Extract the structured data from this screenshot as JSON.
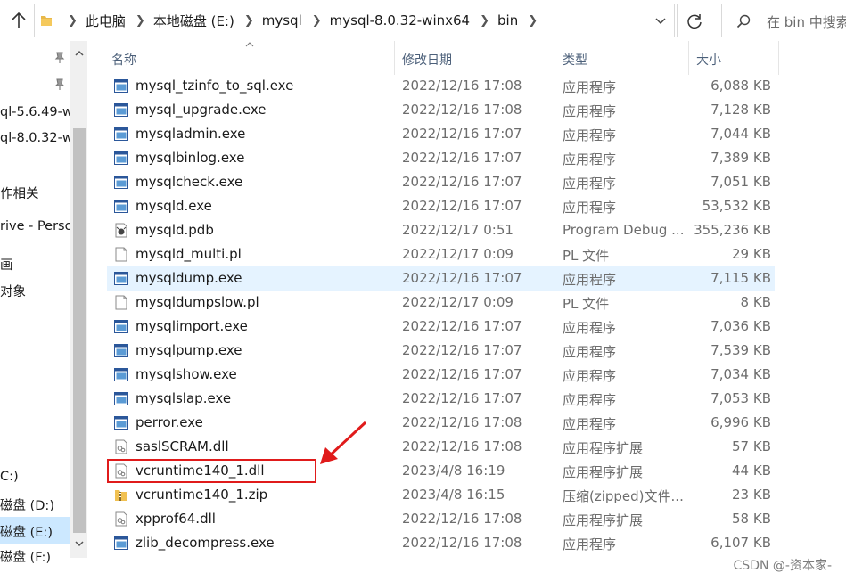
{
  "address": {
    "breadcrumbs": [
      "此电脑",
      "本地磁盘 (E:)",
      "mysql",
      "mysql-8.0.32-winx64",
      "bin"
    ]
  },
  "search": {
    "placeholder": "在 bin 中搜索"
  },
  "nav": {
    "items": [
      "ql-5.6.49-w",
      "ql-8.0.32-w",
      "作相关",
      "rive - Perso",
      "画",
      "对象",
      "C:)",
      "磁盘 (D:)",
      "磁盘 (E:)",
      "磁盘 (F:)"
    ],
    "selected_index": 8
  },
  "columns": {
    "name": "名称",
    "date": "修改日期",
    "type": "类型",
    "size": "大小"
  },
  "files": [
    {
      "name": "mysql_tzinfo_to_sql.exe",
      "date": "2022/12/16 17:08",
      "type": "应用程序",
      "size": "6,088 KB",
      "icon": "exe-icon"
    },
    {
      "name": "mysql_upgrade.exe",
      "date": "2022/12/16 17:08",
      "type": "应用程序",
      "size": "7,128 KB",
      "icon": "exe-icon"
    },
    {
      "name": "mysqladmin.exe",
      "date": "2022/12/16 17:07",
      "type": "应用程序",
      "size": "7,044 KB",
      "icon": "exe-icon"
    },
    {
      "name": "mysqlbinlog.exe",
      "date": "2022/12/16 17:07",
      "type": "应用程序",
      "size": "7,389 KB",
      "icon": "exe-icon"
    },
    {
      "name": "mysqlcheck.exe",
      "date": "2022/12/16 17:07",
      "type": "应用程序",
      "size": "7,051 KB",
      "icon": "exe-icon"
    },
    {
      "name": "mysqld.exe",
      "date": "2022/12/16 17:07",
      "type": "应用程序",
      "size": "53,532 KB",
      "icon": "exe-icon"
    },
    {
      "name": "mysqld.pdb",
      "date": "2022/12/17 0:51",
      "type": "Program Debug ...",
      "size": "355,236 KB",
      "icon": "pdb-icon"
    },
    {
      "name": "mysqld_multi.pl",
      "date": "2022/12/17 0:09",
      "type": "PL 文件",
      "size": "29 KB",
      "icon": "blank-file-icon"
    },
    {
      "name": "mysqldump.exe",
      "date": "2022/12/16 17:07",
      "type": "应用程序",
      "size": "7,115 KB",
      "icon": "exe-icon"
    },
    {
      "name": "mysqldumpslow.pl",
      "date": "2022/12/17 0:09",
      "type": "PL 文件",
      "size": "8 KB",
      "icon": "blank-file-icon"
    },
    {
      "name": "mysqlimport.exe",
      "date": "2022/12/16 17:07",
      "type": "应用程序",
      "size": "7,036 KB",
      "icon": "exe-icon"
    },
    {
      "name": "mysqlpump.exe",
      "date": "2022/12/16 17:07",
      "type": "应用程序",
      "size": "7,539 KB",
      "icon": "exe-icon"
    },
    {
      "name": "mysqlshow.exe",
      "date": "2022/12/16 17:07",
      "type": "应用程序",
      "size": "7,034 KB",
      "icon": "exe-icon"
    },
    {
      "name": "mysqlslap.exe",
      "date": "2022/12/16 17:07",
      "type": "应用程序",
      "size": "7,053 KB",
      "icon": "exe-icon"
    },
    {
      "name": "perror.exe",
      "date": "2022/12/16 17:08",
      "type": "应用程序",
      "size": "6,996 KB",
      "icon": "exe-icon"
    },
    {
      "name": "saslSCRAM.dll",
      "date": "2022/12/16 17:08",
      "type": "应用程序扩展",
      "size": "57 KB",
      "icon": "dll-icon"
    },
    {
      "name": "vcruntime140_1.dll",
      "date": "2023/4/8 16:19",
      "type": "应用程序扩展",
      "size": "44 KB",
      "icon": "dll-icon"
    },
    {
      "name": "vcruntime140_1.zip",
      "date": "2023/4/8 16:15",
      "type": "压缩(zipped)文件...",
      "size": "23 KB",
      "icon": "zip-icon"
    },
    {
      "name": "xpprof64.dll",
      "date": "2022/12/16 17:08",
      "type": "应用程序扩展",
      "size": "58 KB",
      "icon": "dll-icon"
    },
    {
      "name": "zlib_decompress.exe",
      "date": "2022/12/16 17:08",
      "type": "应用程序",
      "size": "6,107 KB",
      "icon": "exe-icon"
    }
  ],
  "hover_index": 8,
  "highlight_index": 16,
  "colors": {
    "accent": "#0078d7",
    "hover": "#e5f3ff",
    "selected": "#cce8ff",
    "annotation": "#e01b1b"
  },
  "watermark": "CSDN @-资本家-"
}
